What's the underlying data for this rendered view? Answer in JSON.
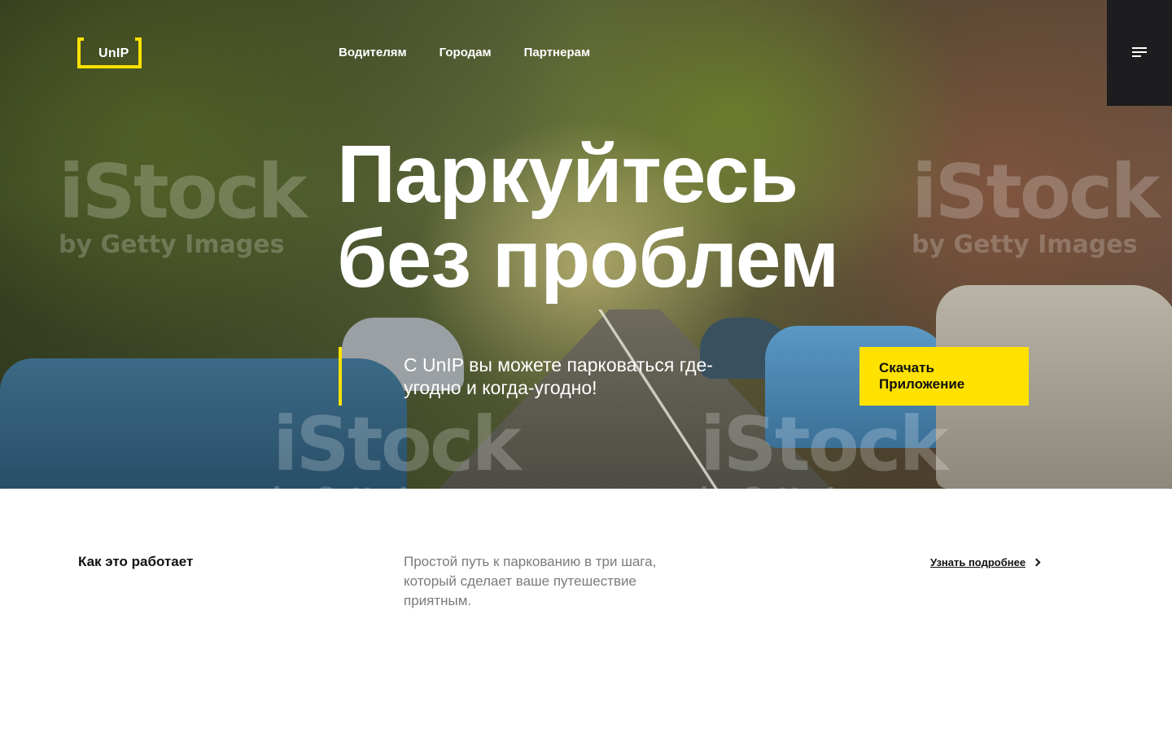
{
  "brand": {
    "logo_text": "UnIP",
    "accent_color": "#ffe200",
    "dark_color": "#1d1d1f"
  },
  "nav": {
    "items": [
      {
        "label": "Водителям"
      },
      {
        "label": "Городам"
      },
      {
        "label": "Партнерам"
      }
    ]
  },
  "menu": {
    "icon": "hamburger-menu-icon"
  },
  "hero": {
    "headline_line1": "Паркуйтесь",
    "headline_line2": "без проблем",
    "subtitle": "С UnIP вы можете парковаться где-угодно и когда-угодно!",
    "cta_line1": "Скачать",
    "cta_line2": "Приложение",
    "watermark_text": "iStock",
    "watermark_subtext": "by Getty Images"
  },
  "how": {
    "title": "Как это работает",
    "description": "Простой путь к паркованию в три шага, который сделает ваше путешествие приятным.",
    "link_label": "Узнать подробнее",
    "link_icon": "chevron-right-icon"
  }
}
